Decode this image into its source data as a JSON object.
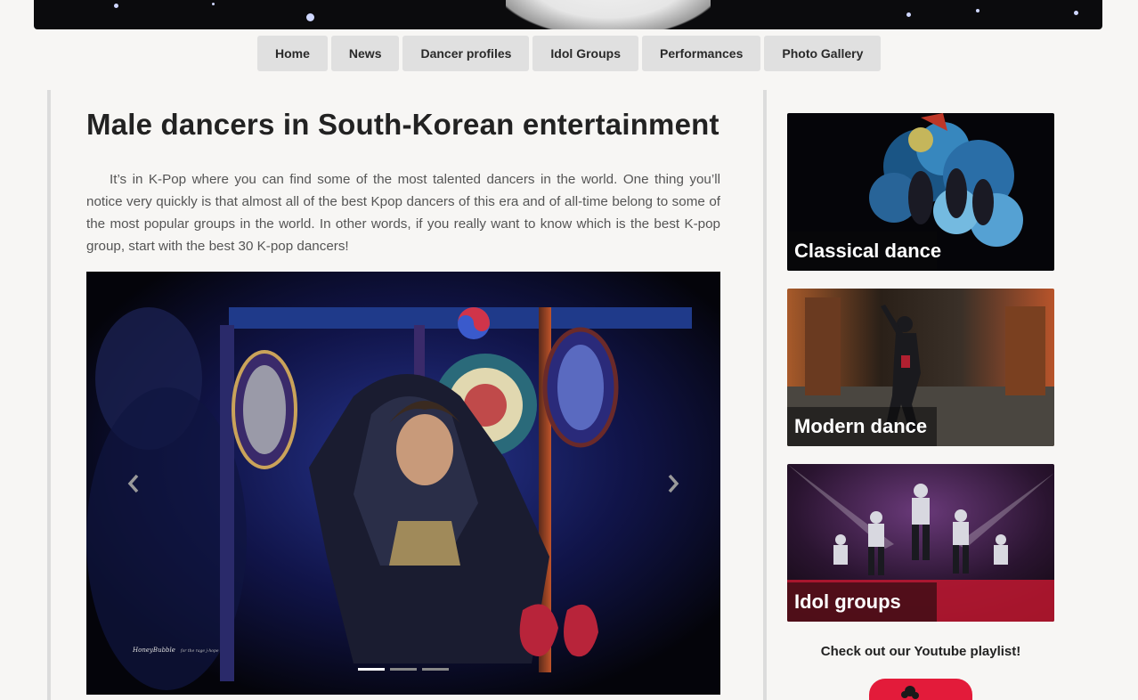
{
  "nav": {
    "items": [
      {
        "label": "Home"
      },
      {
        "label": "News"
      },
      {
        "label": "Dancer profiles"
      },
      {
        "label": "Idol Groups"
      },
      {
        "label": "Performances"
      },
      {
        "label": "Photo Gallery"
      }
    ]
  },
  "main": {
    "title": "Male dancers in South-Korean entertainment",
    "intro": "It’s in K-Pop where you can find some of the most talented dancers in the world. One thing you’ll notice very quickly is that almost all of the best Kpop dancers of this era and of all-time belong to some of the most popular groups in the world. In other words, if you really want to know which is the best K-pop group, start with the best 30 K-pop dancers!"
  },
  "carousel": {
    "watermark": "HoneyBubble",
    "watermark_sub": "for the rage j-hope",
    "prev_icon": "chevron-left-icon",
    "next_icon": "chevron-right-icon",
    "active_slide": 1,
    "slide_count": 3
  },
  "sidebar": {
    "cards": [
      {
        "label": "Classical dance"
      },
      {
        "label": "Modern dance"
      },
      {
        "label": "Idol groups"
      }
    ],
    "youtube_text": "Check out our Youtube playlist!"
  },
  "colors": {
    "background": "#f7f6f4",
    "nav_button": "#e0e0e0",
    "youtube_red": "#e31b3a"
  }
}
